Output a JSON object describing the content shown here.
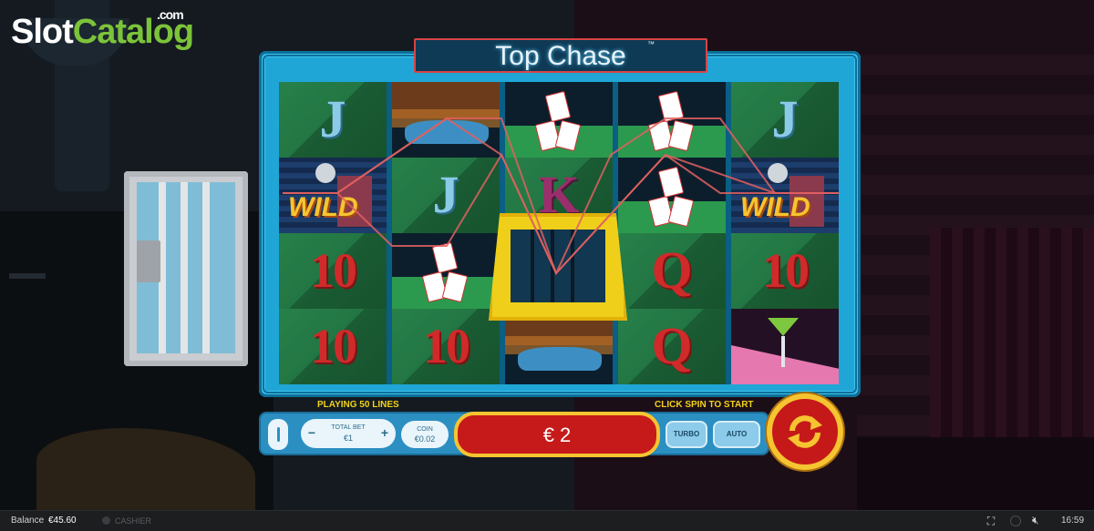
{
  "logo": {
    "slot": "Slot",
    "catalog": "Catalog",
    "domain": ".com"
  },
  "game": {
    "title": "Top Chase",
    "trademark": "™",
    "reels": [
      [
        "J",
        "WILD",
        "10",
        "10"
      ],
      [
        "car",
        "J",
        "cards",
        "10"
      ],
      [
        "cards",
        "K",
        "jail",
        "car"
      ],
      [
        "cards",
        "cards",
        "Q",
        "Q"
      ],
      [
        "J",
        "WILD",
        "10",
        "martini"
      ]
    ],
    "status_left": "PLAYING 50 LINES",
    "status_right": "CLICK SPIN TO START"
  },
  "controls": {
    "total_bet_label": "TOTAL BET",
    "total_bet_value": "€1",
    "minus": "−",
    "plus": "+",
    "coin_label": "COIN",
    "coin_value": "€0.02",
    "win_value": "€ 2",
    "turbo_label": "TURBO",
    "auto_label": "AUTO"
  },
  "statusbar": {
    "balance_label": "Balance",
    "balance_value": "€45.60",
    "cashier_label": "CASHIER",
    "time": "16:59"
  },
  "colors": {
    "frame": "#1fa6d6",
    "win_box": "#c61a1a",
    "spin_button": "#c51919",
    "gold": "#f6c430",
    "status_text": "#f1d21a",
    "payline": "#e06060"
  }
}
